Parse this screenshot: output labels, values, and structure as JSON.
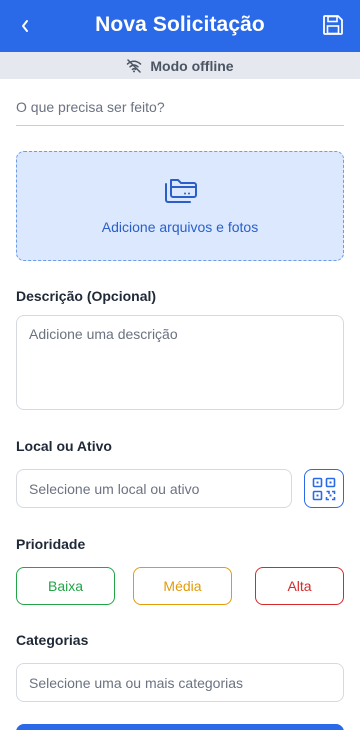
{
  "header": {
    "title": "Nova Solicitação",
    "back_icon": "chevron-left-icon",
    "save_icon": "floppy-disk-icon",
    "background": "#2a6ae9"
  },
  "offline": {
    "label": "Modo offline",
    "icon": "wifi-off-icon"
  },
  "what_field": {
    "placeholder": "O que precisa ser feito?"
  },
  "upload": {
    "label": "Adicione arquivos e fotos",
    "icon": "folders-icon"
  },
  "description": {
    "label": "Descrição (Opcional)",
    "placeholder": "Adicione uma descrição"
  },
  "location": {
    "label": "Local ou Ativo",
    "placeholder": "Selecione um local ou ativo",
    "qr_icon": "qr-code-icon"
  },
  "priority": {
    "label": "Prioridade",
    "options": [
      {
        "label": "Baixa",
        "color": "#22a447"
      },
      {
        "label": "Média",
        "color": "#e39b0a"
      },
      {
        "label": "Alta",
        "color": "#d62a2a"
      }
    ]
  },
  "categories": {
    "label": "Categorias",
    "placeholder": "Selecione uma ou mais categorias"
  }
}
